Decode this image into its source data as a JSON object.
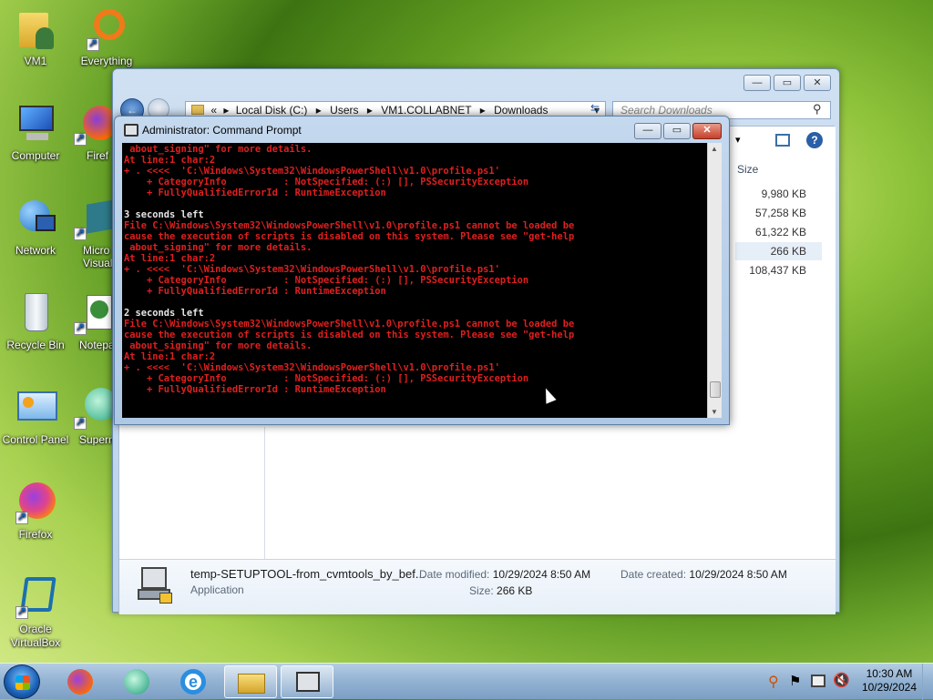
{
  "desktop": {
    "icons": [
      {
        "label": "VM1"
      },
      {
        "label": "Everything"
      },
      {
        "label": "Computer"
      },
      {
        "label": "Firef"
      },
      {
        "label": "Network"
      },
      {
        "label": "Micro\nVisual S"
      },
      {
        "label": "Recycle Bin"
      },
      {
        "label": "Notepa"
      },
      {
        "label": "Control Panel"
      },
      {
        "label": "Superm"
      },
      {
        "label": "Firefox"
      },
      {
        "label": "Oracle\nVirtualBox"
      }
    ]
  },
  "explorer": {
    "breadcrumb": [
      "«",
      "Local Disk (C:)",
      "Users",
      "VM1.COLLABNET",
      "Downloads"
    ],
    "search_placeholder": "Search Downloads",
    "size_header": "Size",
    "sizes": [
      "9,980 KB",
      "57,258 KB",
      "61,322 KB",
      "266 KB",
      "108,437 KB"
    ],
    "selected_index": 3,
    "details": {
      "filename": "temp-SETUPTOOL-from_cvmtools_by_bef...",
      "type": "Application",
      "modified_label": "Date modified:",
      "modified_value": "10/29/2024 8:50 AM",
      "created_label": "Date created:",
      "created_value": "10/29/2024 8:50 AM",
      "size_label": "Size:",
      "size_value": "266 KB"
    }
  },
  "cmd": {
    "title": "Administrator: Command Prompt",
    "lines": [
      {
        "c": "r",
        "t": " about_signing\" for more details."
      },
      {
        "c": "r",
        "t": "At line:1 char:2"
      },
      {
        "c": "r",
        "t": "+ . <<<<  'C:\\Windows\\System32\\WindowsPowerShell\\v1.0\\profile.ps1'"
      },
      {
        "c": "r",
        "t": "    + CategoryInfo          : NotSpecified: (:) [], PSSecurityException"
      },
      {
        "c": "r",
        "t": "    + FullyQualifiedErrorId : RuntimeException"
      },
      {
        "c": "r",
        "t": ""
      },
      {
        "c": "w",
        "t": "3 seconds left"
      },
      {
        "c": "r",
        "t": "File C:\\Windows\\System32\\WindowsPowerShell\\v1.0\\profile.ps1 cannot be loaded be"
      },
      {
        "c": "r",
        "t": "cause the execution of scripts is disabled on this system. Please see \"get-help"
      },
      {
        "c": "r",
        "t": " about_signing\" for more details."
      },
      {
        "c": "r",
        "t": "At line:1 char:2"
      },
      {
        "c": "r",
        "t": "+ . <<<<  'C:\\Windows\\System32\\WindowsPowerShell\\v1.0\\profile.ps1'"
      },
      {
        "c": "r",
        "t": "    + CategoryInfo          : NotSpecified: (:) [], PSSecurityException"
      },
      {
        "c": "r",
        "t": "    + FullyQualifiedErrorId : RuntimeException"
      },
      {
        "c": "r",
        "t": ""
      },
      {
        "c": "w",
        "t": "2 seconds left"
      },
      {
        "c": "r",
        "t": "File C:\\Windows\\System32\\WindowsPowerShell\\v1.0\\profile.ps1 cannot be loaded be"
      },
      {
        "c": "r",
        "t": "cause the execution of scripts is disabled on this system. Please see \"get-help"
      },
      {
        "c": "r",
        "t": " about_signing\" for more details."
      },
      {
        "c": "r",
        "t": "At line:1 char:2"
      },
      {
        "c": "r",
        "t": "+ . <<<<  'C:\\Windows\\System32\\WindowsPowerShell\\v1.0\\profile.ps1'"
      },
      {
        "c": "r",
        "t": "    + CategoryInfo          : NotSpecified: (:) [], PSSecurityException"
      },
      {
        "c": "r",
        "t": "    + FullyQualifiedErrorId : RuntimeException"
      }
    ]
  },
  "taskbar": {
    "time": "10:30 AM",
    "date": "10/29/2024"
  }
}
